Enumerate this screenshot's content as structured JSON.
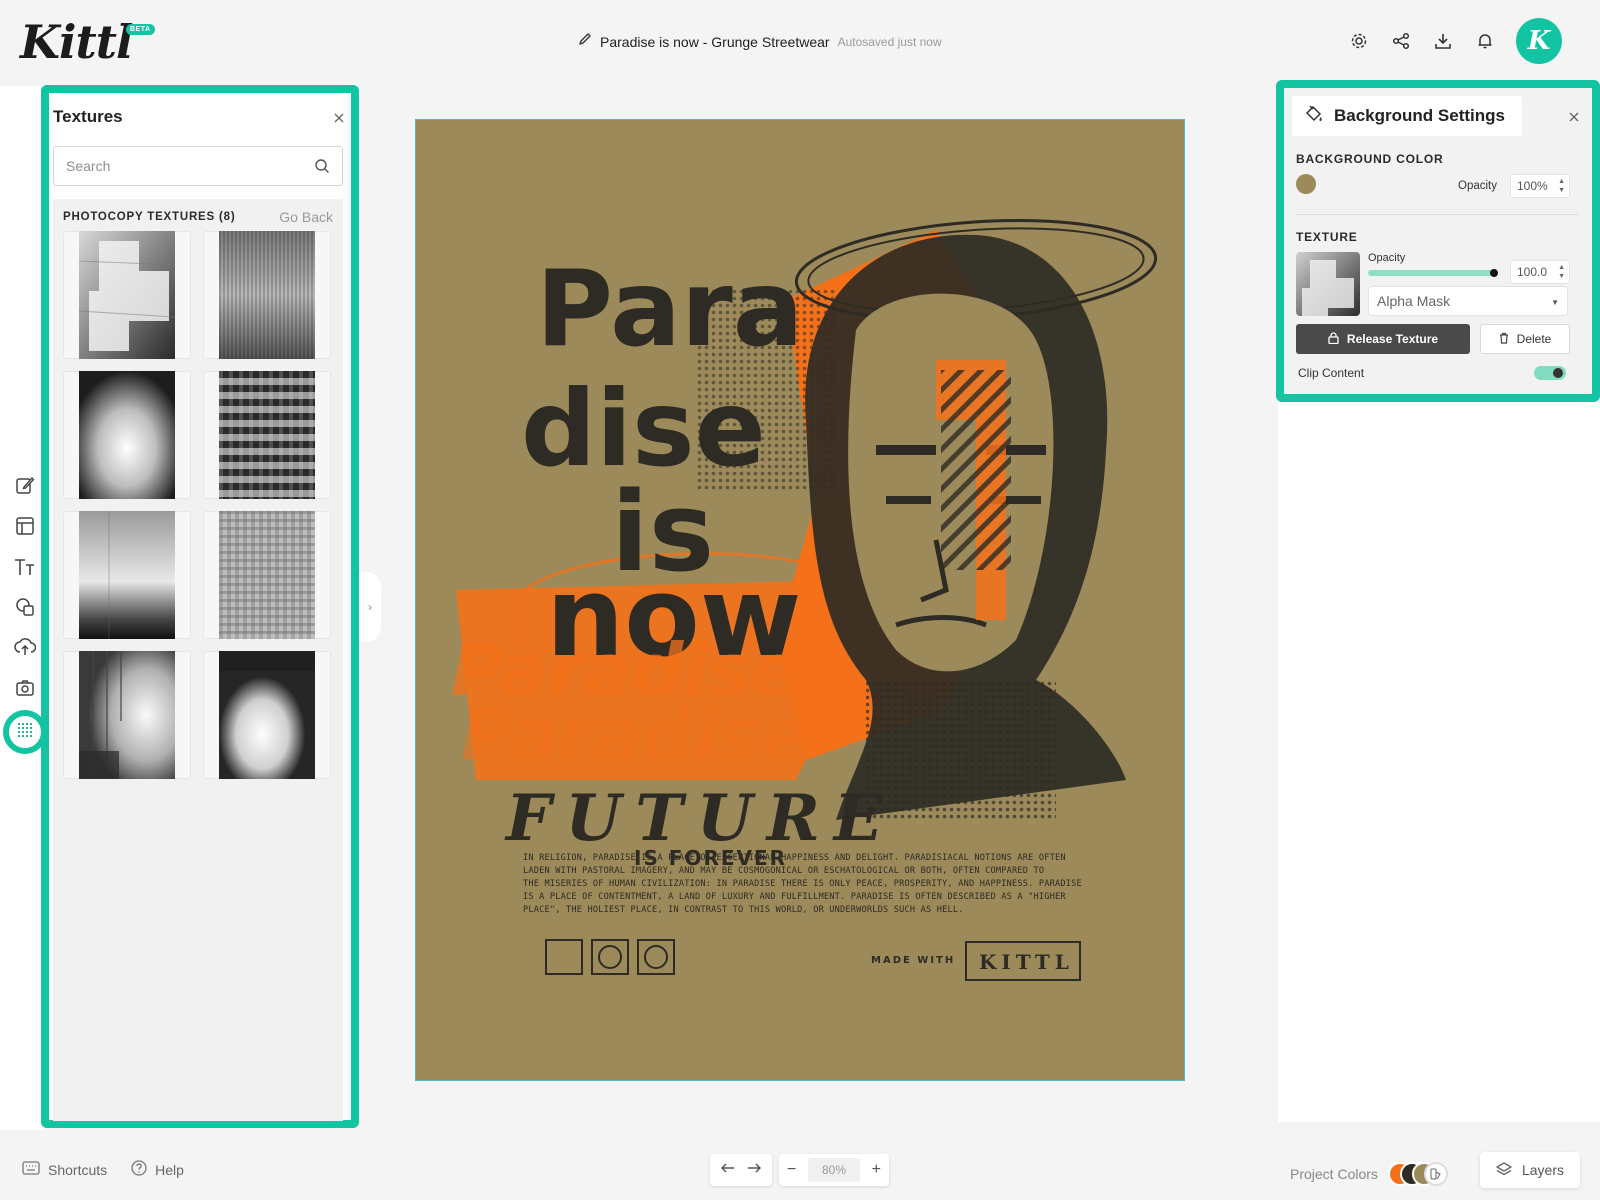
{
  "app": {
    "logo": "Kittl",
    "logo_badge": "BETA",
    "avatar_letter": "K"
  },
  "header": {
    "doc_title": "Paradise is now - Grunge Streetwear",
    "save_status": "Autosaved just now"
  },
  "textures_panel": {
    "title": "Textures",
    "search_placeholder": "Search",
    "section_label": "PHOTOCOPY TEXTURES (8)",
    "go_back": "Go Back",
    "textures": [
      "photocopy-1",
      "photocopy-2",
      "photocopy-3",
      "photocopy-4",
      "photocopy-5",
      "photocopy-6",
      "photocopy-7",
      "photocopy-8"
    ]
  },
  "background_settings": {
    "title": "Background Settings",
    "bg_color_label": "BACKGROUND COLOR",
    "bg_color": "#9c8a5a",
    "opacity_label": "Opacity",
    "opacity_value": "100%",
    "texture_label": "TEXTURE",
    "texture_opacity_label": "Opacity",
    "texture_opacity_value": "100.0",
    "texture_opacity": 1.0,
    "mask_mode": "Alpha Mask",
    "release_button": "Release Texture",
    "delete_button": "Delete",
    "clip_content_label": "Clip Content",
    "clip_content": true
  },
  "artwork": {
    "headline_lines": [
      "Para",
      "dise",
      "is",
      "now"
    ],
    "ghost_lines": [
      "Paradise",
      "Paradise"
    ],
    "future": "FUTURE",
    "is_forever": "IS FOREVER",
    "body_lines": [
      "IN RELIGION, PARADISE IS A PLACE OF EXCEPTIONAL HAPPINESS AND DELIGHT. PARADISIACAL NOTIONS ARE OFTEN",
      "LADEN WITH PASTORAL IMAGERY, AND MAY BE COSMOGONICAL OR ESCHATOLOGICAL OR BOTH, OFTEN COMPARED TO",
      "THE MISERIES OF HUMAN CIVILIZATION: IN PARADISE THERE IS ONLY PEACE, PROSPERITY, AND HAPPINESS. PARADISE",
      "IS A PLACE OF CONTENTMENT, A LAND OF LUXURY AND FULFILLMENT. PARADISE IS OFTEN DESCRIBED AS A \"HIGHER",
      "PLACE\", THE HOLIEST PLACE, IN CONTRAST TO THIS WORLD, OR UNDERWORLDS SUCH AS HELL."
    ],
    "made_with": "MADE WITH",
    "brand_stamp": "KITTL"
  },
  "bottom_bar": {
    "shortcuts": "Shortcuts",
    "help": "Help",
    "zoom_value": "80%",
    "project_colors": "Project Colors",
    "layers": "Layers"
  },
  "colors": {
    "accent": "#13c4a3",
    "canvas_bg": "#9c8a5a",
    "ink": "#2e2b24",
    "orange": "#f4711a",
    "project_colors": [
      "#f4711a",
      "#2e2b24",
      "#9c8a5a"
    ]
  },
  "tools": [
    "edit-icon",
    "templates-icon",
    "text-icon",
    "shapes-icon",
    "upload-icon",
    "photo-icon",
    "textures-icon"
  ]
}
